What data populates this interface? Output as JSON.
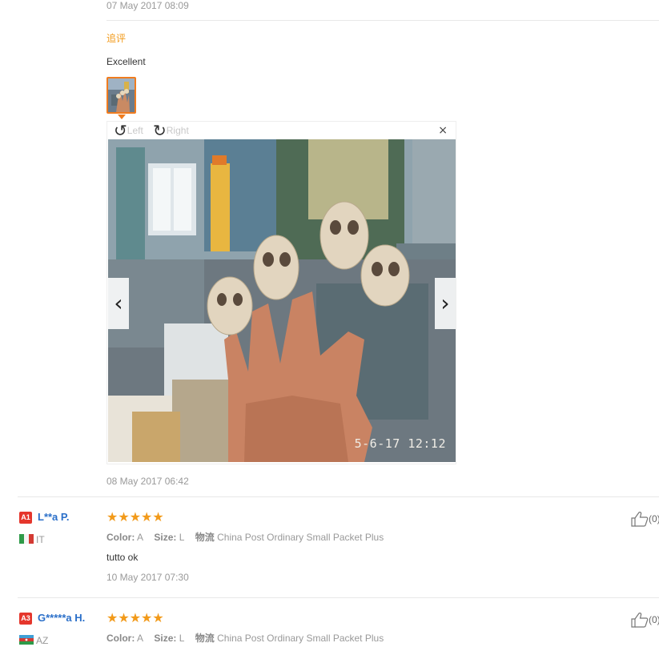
{
  "top_review": {
    "date": "07 May 2017 08:09",
    "followup_label": "追评",
    "followup_text": "Excellent",
    "viewer": {
      "rotate_left": "Left",
      "rotate_right": "Right",
      "close": "×",
      "photo_stamp": "5-6-17  12:12",
      "prev": "‹",
      "next": "›"
    },
    "followup_date": "08 May 2017 06:42"
  },
  "reviews": [
    {
      "level": "A1",
      "user": "L**a P.",
      "country": "IT",
      "stars": "★★★★★",
      "color_label": "Color:",
      "color_value": "A",
      "size_label": "Size:",
      "size_value": "L",
      "logistics_label": "物流",
      "logistics_value": "China Post Ordinary Small Packet Plus",
      "text": "tutto ok",
      "date": "10 May 2017 07:30",
      "helpful": "(0)"
    },
    {
      "level": "A3",
      "user": "G*****a H.",
      "country": "AZ",
      "stars": "★★★★★",
      "color_label": "Color:",
      "color_value": "A",
      "size_label": "Size:",
      "size_value": "L",
      "logistics_label": "物流",
      "logistics_value": "China Post Ordinary Small Packet Plus",
      "helpful": "(0)"
    }
  ],
  "colors": {
    "accent_orange": "#f29a1a",
    "username_blue": "#2a6fc9",
    "level_red": "#e5362c"
  }
}
